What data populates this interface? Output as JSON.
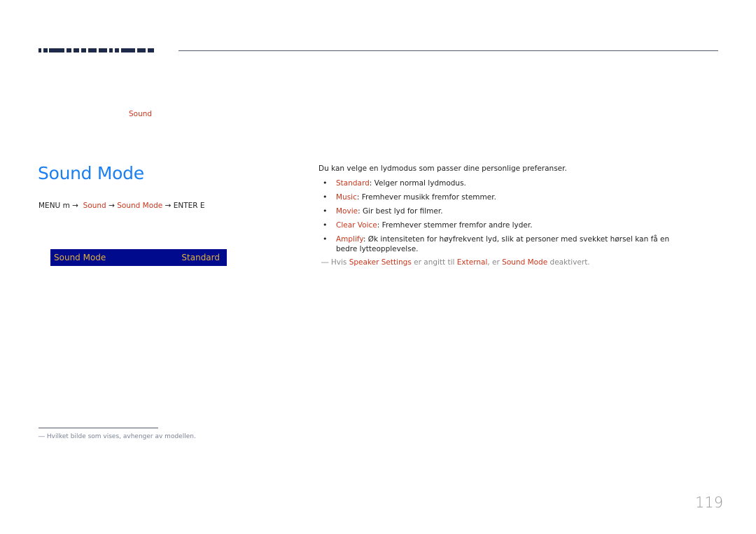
{
  "header": {
    "chapter_title_fragment": "",
    "breadcrumb_sound": "Sound"
  },
  "section": {
    "title": "Sound Mode",
    "menu_path": {
      "menu": "MENU m",
      "arrow": "→",
      "step1": "Sound",
      "step2": "Sound Mode",
      "enter": "ENTER E"
    },
    "osd": {
      "label": "Sound Mode",
      "value": "Standard",
      "background": "#000a8c",
      "text_color": "#e0b040"
    }
  },
  "content": {
    "description": "Du kan velge en lydmodus som passer dine personlige preferanser.",
    "options": [
      {
        "name": "Standard",
        "text": ": Velger normal lydmodus."
      },
      {
        "name": "Music",
        "text": ": Fremhever musikk fremfor stemmer."
      },
      {
        "name": "Movie",
        "text": ": Gir best lyd for filmer."
      },
      {
        "name": "Clear Voice",
        "text": ": Fremhever stemmer fremfor andre lyder."
      },
      {
        "name": "Amplify",
        "text": ": Øk intensiteten for høyfrekvent lyd, slik at personer med svekket hørsel kan få en bedre lytteopplevelse."
      }
    ],
    "note": {
      "dash": "―",
      "p1": " Hvis ",
      "k1": "Speaker Settings",
      "p2": " er angitt til ",
      "k2": "External",
      "p3": ", er ",
      "k3": "Sound Mode",
      "p4": " deaktivert."
    }
  },
  "footer": {
    "note": "―  Hvilket bilde som vises, avhenger av modellen.",
    "page_number": "119"
  },
  "colors": {
    "title_blue": "#1a7ff0",
    "keyword_red": "#c8361b"
  }
}
